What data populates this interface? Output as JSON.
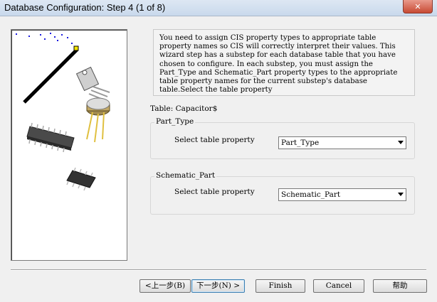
{
  "window": {
    "title": "Database Configuration: Step 4 (1 of 8)",
    "close_label": "✕"
  },
  "description": "You need to assign CIS property types to appropriate table property names so CIS will correctly interpret their values. This wizard step has a substep for each database table that you have chosen to configure. In each substep, you must assign the Part_Type and Schematic_Part property types to the appropriate table property names for the current substep's database table.Select the table property",
  "table_label": "Table: Capacitor$",
  "part_type": {
    "legend": "Part_Type",
    "prompt": "Select table property",
    "value": "Part_Type"
  },
  "schematic_part": {
    "legend": "Schematic_Part",
    "prompt": "Select table property",
    "value": "Schematic_Part"
  },
  "buttons": {
    "back": "<上一步(B)",
    "next": "下一步(N) >",
    "finish": "Finish",
    "cancel": "Cancel",
    "help": "帮助"
  },
  "colors": {
    "titlebar": "#c9d9ec",
    "wand": "#000000",
    "sparkle": "#1a1adf",
    "wand_tip": "#f2e200"
  }
}
